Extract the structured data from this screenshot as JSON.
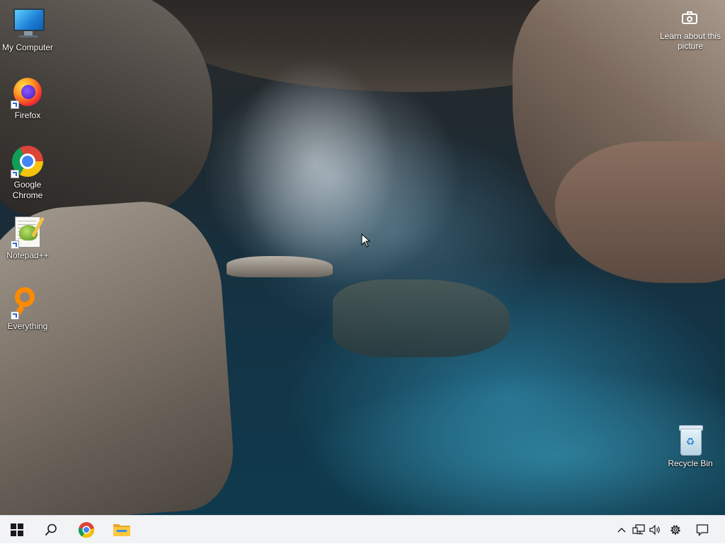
{
  "desktop": {
    "icons": [
      {
        "label": "My Computer"
      },
      {
        "label": "Firefox"
      },
      {
        "label": "Google Chrome"
      },
      {
        "label": "Notepad++"
      },
      {
        "label": "Everything"
      },
      {
        "label": "Recycle Bin"
      }
    ],
    "learn_about": "Learn about this picture"
  },
  "taskbar": {
    "start": "start-icon",
    "search": "search-icon",
    "pinned": [
      "chrome-icon",
      "file-explorer-icon"
    ],
    "tray": [
      "chevron-up-icon",
      "network-icon",
      "volume-icon",
      "settings-icon",
      "notification-icon"
    ]
  },
  "colors": {
    "taskbar_bg": "#f1f3f5",
    "accent_blue": "#0078d7"
  }
}
